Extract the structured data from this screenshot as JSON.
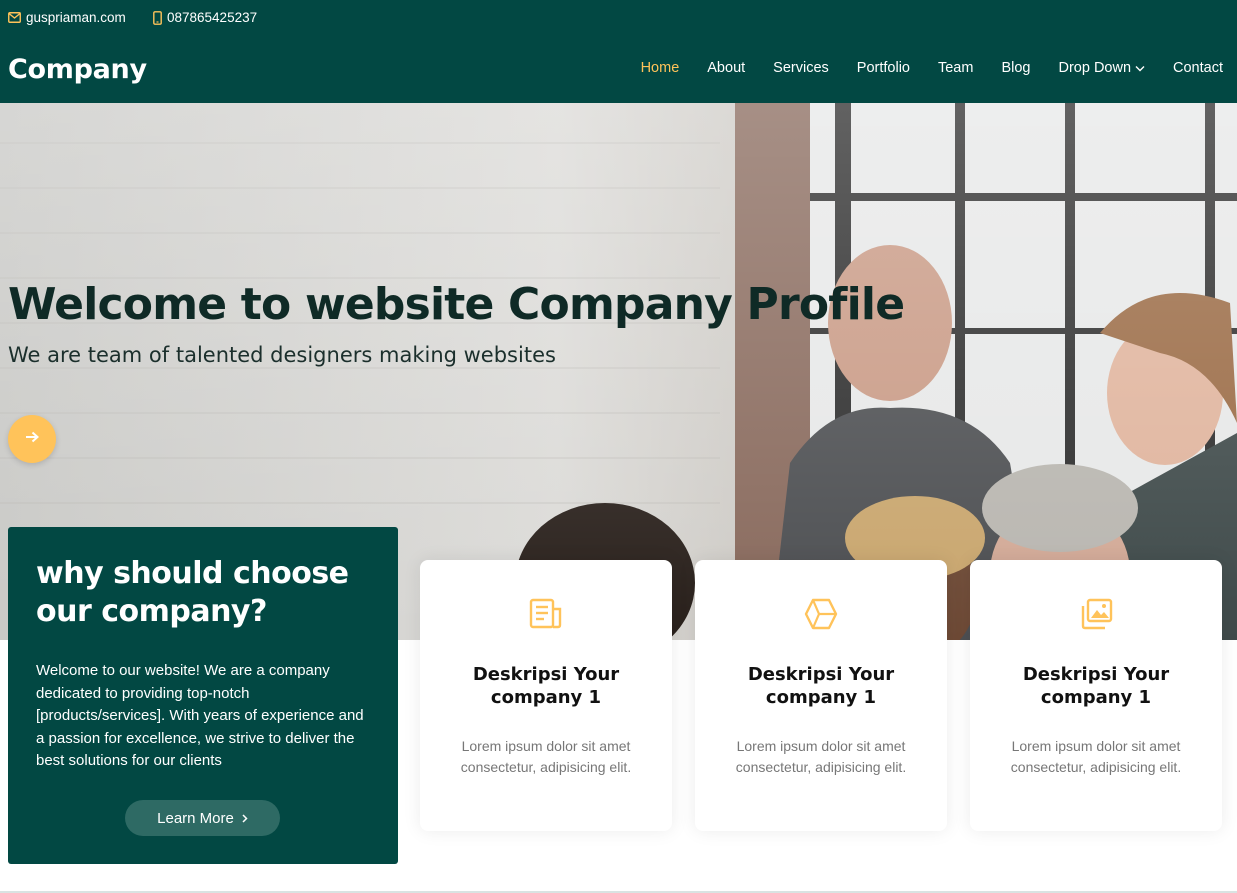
{
  "topbar": {
    "email": "guspriaman.com",
    "phone": "087865425237",
    "email_icon": "envelope-icon",
    "phone_icon": "phone-icon"
  },
  "header": {
    "logo": "Company",
    "nav": [
      {
        "label": "Home",
        "active": true
      },
      {
        "label": "About"
      },
      {
        "label": "Services"
      },
      {
        "label": "Portfolio"
      },
      {
        "label": "Team"
      },
      {
        "label": "Blog"
      },
      {
        "label": "Drop Down",
        "has_dropdown": true
      },
      {
        "label": "Contact"
      }
    ]
  },
  "hero": {
    "title": "Welcome to website Company Profile",
    "subtitle": "We are team of talented designers making websites",
    "button_icon": "arrow-right-icon"
  },
  "why": {
    "title": "why should choose our company?",
    "text": "Welcome to our website! We are a company dedicated to providing top-notch [products/services]. With years of experience and a passion for excellence, we strive to deliver the best solutions for our clients",
    "button": "Learn More"
  },
  "cards": [
    {
      "icon": "newspaper-icon",
      "title": "Deskripsi Your company 1",
      "text": "Lorem ipsum dolor sit amet consectetur, adipisicing elit."
    },
    {
      "icon": "hexagon-cube-icon",
      "title": "Deskripsi Your company 1",
      "text": "Lorem ipsum dolor sit amet consectetur, adipisicing elit."
    },
    {
      "icon": "images-icon",
      "title": "Deskripsi Your company 1",
      "text": "Lorem ipsum dolor sit amet consectetur, adipisicing elit."
    }
  ],
  "colors": {
    "primary": "#024843",
    "accent": "#ffc35a",
    "button": "#2e6a64"
  }
}
